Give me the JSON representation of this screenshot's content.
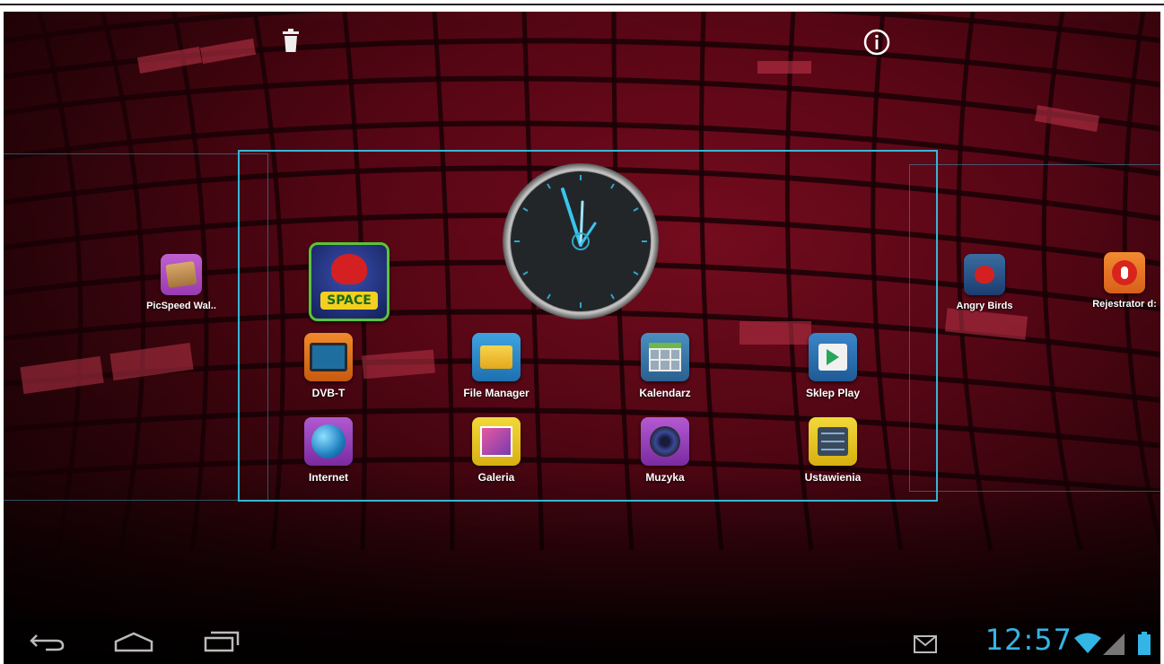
{
  "toolbar": {
    "delete_icon": "trash-icon",
    "info_icon": "info-icon"
  },
  "side_left_apps": [
    {
      "label": "PicSpeed Wal..",
      "icon": "wallpaper-icon"
    }
  ],
  "side_right_apps": [
    {
      "label": "Angry Birds",
      "icon": "angry-birds-space-icon"
    },
    {
      "label": "Rejestrator d:",
      "icon": "recorder-icon"
    }
  ],
  "featured_app": {
    "icon": "angry-birds-space-icon",
    "badge": "SPACE"
  },
  "widget": {
    "icon": "analog-clock-widget"
  },
  "apps_row1": [
    {
      "label": "DVB-T",
      "icon": "tv-icon"
    },
    {
      "label": "File Manager",
      "icon": "folder-icon"
    },
    {
      "label": "Kalendarz",
      "icon": "calendar-icon"
    },
    {
      "label": "Sklep Play",
      "icon": "play-store-icon"
    }
  ],
  "apps_row2": [
    {
      "label": "Internet",
      "icon": "globe-icon"
    },
    {
      "label": "Galeria",
      "icon": "gallery-icon"
    },
    {
      "label": "Muzyka",
      "icon": "speaker-icon"
    },
    {
      "label": "Ustawienia",
      "icon": "settings-icon"
    }
  ],
  "statusbar": {
    "time": "12:57",
    "accent": "#33b5e5"
  },
  "navigation": {
    "back": "back-icon",
    "home": "home-icon",
    "recents": "recents-icon"
  },
  "colors": {
    "frame": "#37b5d6",
    "wallpaper": "#6a0a1b"
  }
}
